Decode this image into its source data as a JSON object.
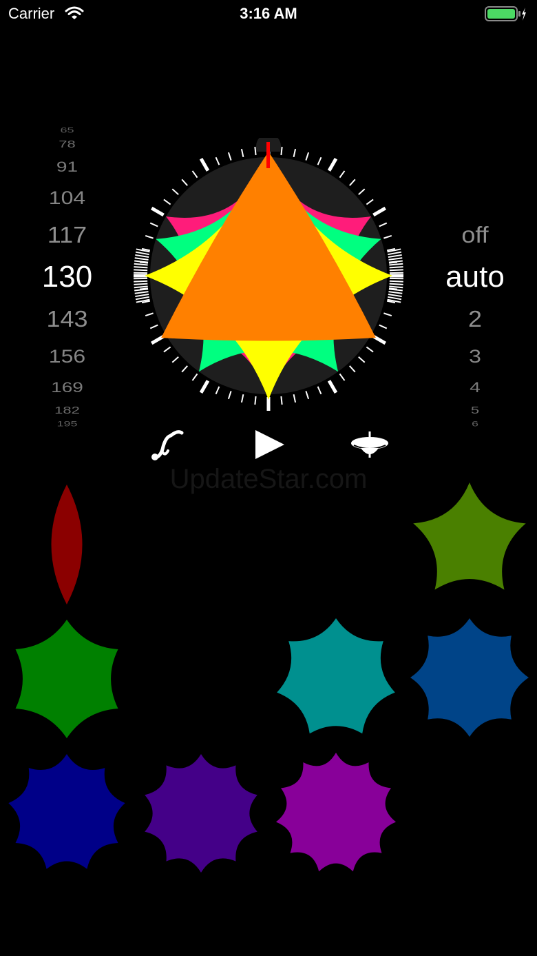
{
  "status_bar": {
    "carrier": "Carrier",
    "time": "3:16 AM",
    "battery_color": "#4cd964"
  },
  "bpm_picker": {
    "values": [
      "65",
      "78",
      "91",
      "104",
      "117",
      "130",
      "143",
      "156",
      "169",
      "182",
      "195"
    ],
    "selected": "130"
  },
  "mode_picker": {
    "values": [
      "off",
      "auto",
      "2",
      "3",
      "4",
      "5",
      "6"
    ],
    "selected": "auto"
  },
  "dial": {
    "ring_color": "#1e1e1e",
    "layers": [
      {
        "sides": 6,
        "color": "#ff1c7a"
      },
      {
        "sides": 5,
        "color": "#00ff80"
      },
      {
        "sides": 4,
        "color": "#ffff00"
      },
      {
        "sides": 3,
        "color": "#ff8000"
      }
    ],
    "needle_color": "#ff0000"
  },
  "controls": {
    "curve": "curve-icon",
    "play": "play-icon",
    "spinner": "spinning-top-icon"
  },
  "watermark": "UpdateStar.com",
  "shapes": [
    {
      "name": "shape-2-sides",
      "sides": 2,
      "color": "#8b0000"
    },
    {
      "name": "shape-5-sides",
      "sides": 5,
      "color": "#4a8000"
    },
    {
      "name": "shape-6-sides",
      "sides": 6,
      "color": "#008000"
    },
    {
      "name": "shape-7-sides",
      "sides": 7,
      "color": "#00908f"
    },
    {
      "name": "shape-8-sides",
      "sides": 8,
      "color": "#004488"
    },
    {
      "name": "shape-9-sides",
      "sides": 9,
      "color": "#000088"
    },
    {
      "name": "shape-10-sides",
      "sides": 10,
      "color": "#440088"
    },
    {
      "name": "shape-11-sides",
      "sides": 11,
      "color": "#880099"
    }
  ]
}
